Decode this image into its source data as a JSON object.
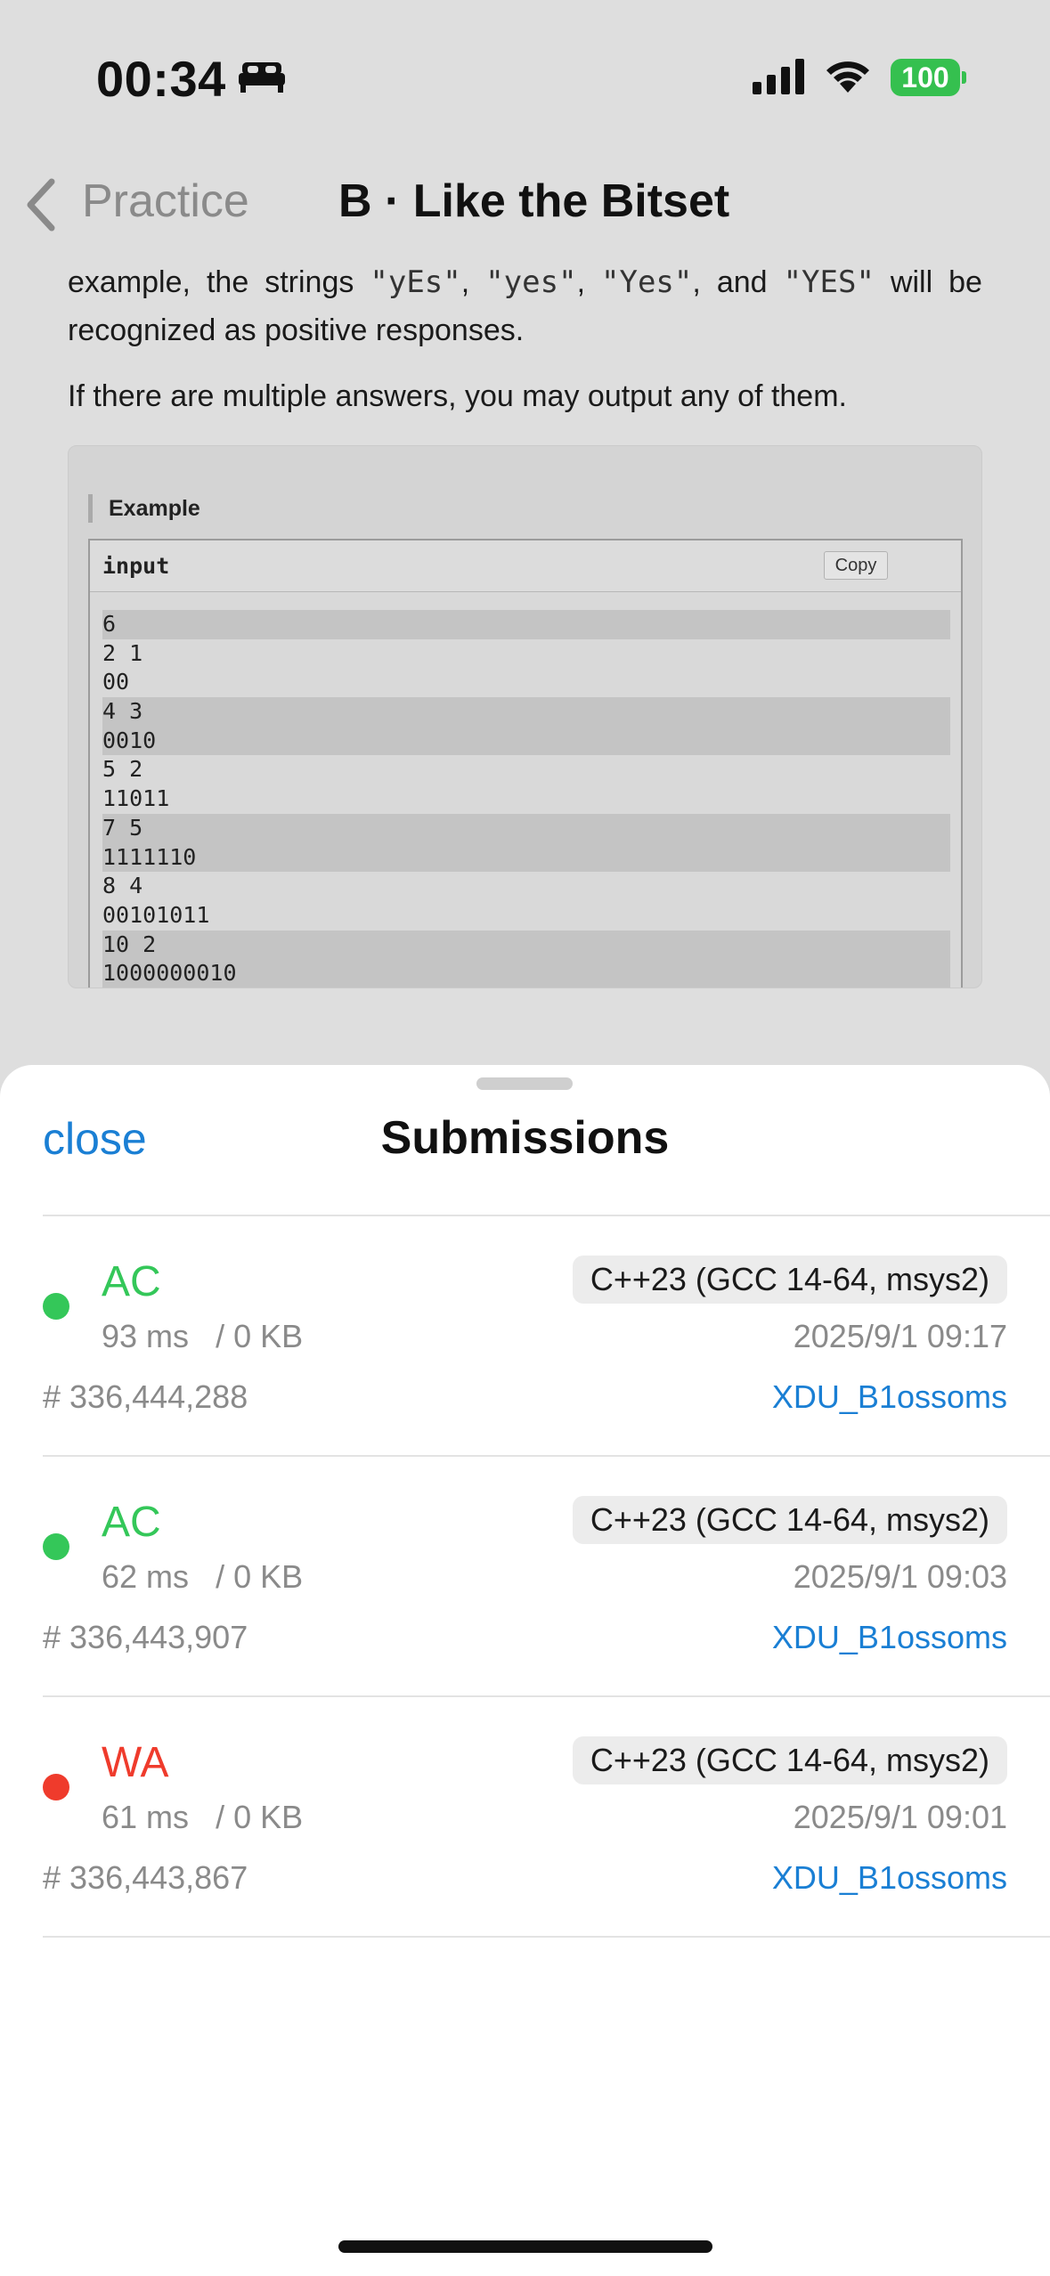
{
  "status_bar": {
    "time": "00:34",
    "battery": "100",
    "icons": [
      "bed-icon",
      "signal-icon",
      "wifi-icon",
      "battery-icon"
    ]
  },
  "nav": {
    "back_label": "Practice",
    "title": "B · Like the Bitset"
  },
  "problem": {
    "para1_a": "example, the strings ",
    "q1": "\"yEs\"",
    "sep1": ", ",
    "q2": "\"yes\"",
    "sep2": ", ",
    "q3": "\"Yes\"",
    "sep3": ", and ",
    "q4": "\"YES\"",
    "para1_b": " will be recognized as positive responses.",
    "para2": "If there are multiple answers, you may output any of them."
  },
  "example": {
    "title": "Example",
    "input_label": "input",
    "copy_label": "Copy",
    "lines": [
      "6",
      "2 1",
      "00",
      "4 3",
      "0010",
      "5 2",
      "11011",
      "7 5",
      "1111110",
      "8 4",
      "00101011",
      "10 2",
      "1000000010"
    ]
  },
  "sheet": {
    "close_label": "close",
    "title": "Submissions",
    "submissions": [
      {
        "verdict": "AC",
        "status_color": "#34c759",
        "time_ms": "93 ms",
        "memory": "/ 0 KB",
        "id": "# 336,444,288",
        "language": "C++23 (GCC 14-64, msys2)",
        "submitted": "2025/9/1 09:17",
        "user": "XDU_B1ossoms"
      },
      {
        "verdict": "AC",
        "status_color": "#34c759",
        "time_ms": "62 ms",
        "memory": "/ 0 KB",
        "id": "# 336,443,907",
        "language": "C++23 (GCC 14-64, msys2)",
        "submitted": "2025/9/1 09:03",
        "user": "XDU_B1ossoms"
      },
      {
        "verdict": "WA",
        "status_color": "#ef3b2c",
        "time_ms": "61 ms",
        "memory": "/ 0 KB",
        "id": "# 336,443,867",
        "language": "C++23 (GCC 14-64, msys2)",
        "submitted": "2025/9/1 09:01",
        "user": "XDU_B1ossoms"
      }
    ]
  },
  "colors": {
    "accent": "#1a7fd4",
    "ac": "#34c759",
    "wa": "#ef3b2c"
  }
}
